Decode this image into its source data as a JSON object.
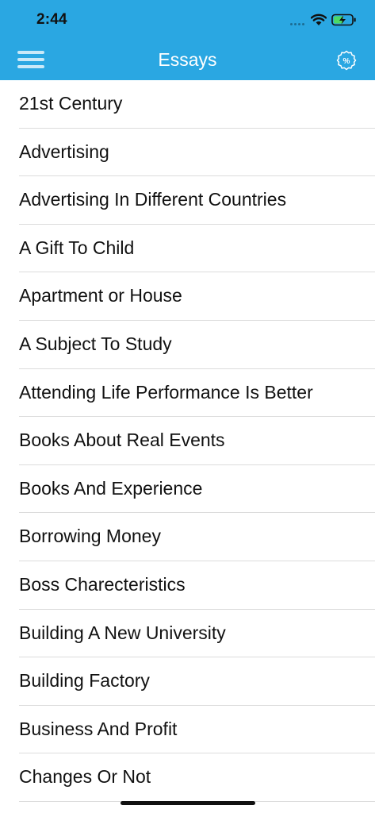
{
  "status_bar": {
    "time": "2:44"
  },
  "nav": {
    "title": "Essays",
    "menu_icon": "hamburger-menu-icon",
    "right_icon": "discount-badge-icon"
  },
  "colors": {
    "header": "#2aa7e2",
    "battery_fill": "#4cd964"
  },
  "essays": [
    "21st Century",
    "Advertising",
    "Advertising In Different Countries",
    "A Gift To Child",
    "Apartment or House",
    "A Subject To Study",
    "Attending Life Performance Is Better",
    "Books About Real Events",
    "Books And Experience",
    "Borrowing Money",
    "Boss Charecteristics",
    "Building A New University",
    "Building Factory",
    "Business And Profit",
    "Changes Or Not"
  ]
}
